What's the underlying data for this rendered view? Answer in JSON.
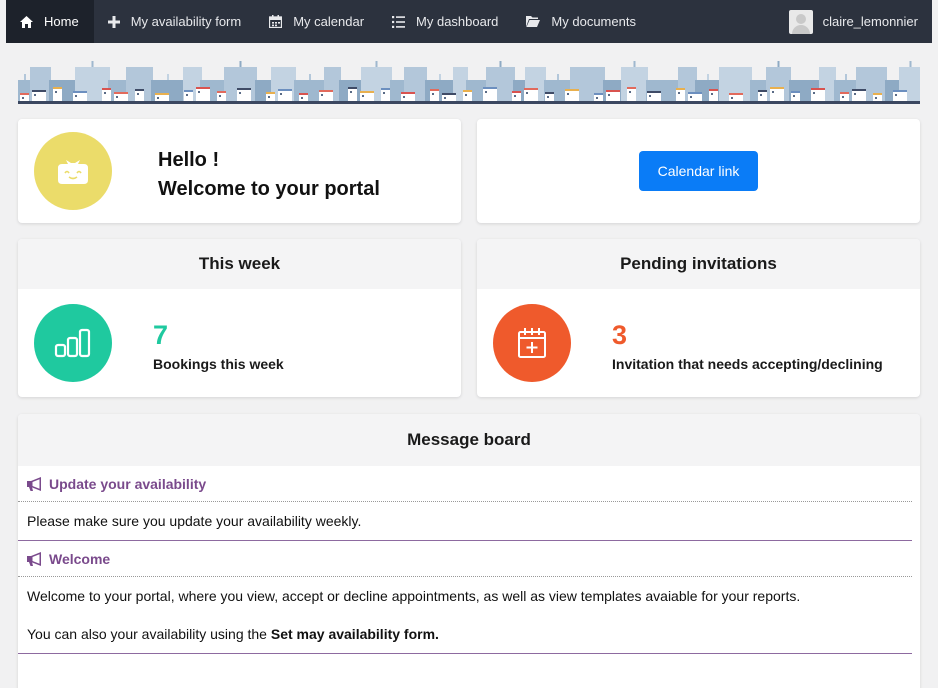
{
  "nav": {
    "items": [
      {
        "label": "Home",
        "icon": "home-icon",
        "active": true
      },
      {
        "label": "My availability form",
        "icon": "plus-icon"
      },
      {
        "label": "My calendar",
        "icon": "calendar-icon"
      },
      {
        "label": "My dashboard",
        "icon": "list-icon"
      },
      {
        "label": "My documents",
        "icon": "folder-icon"
      }
    ],
    "username": "claire_lemonnier"
  },
  "welcome": {
    "line1": "Hello !",
    "line2": "Welcome to your portal"
  },
  "calendar_button": "Calendar link",
  "week": {
    "title": "This week",
    "count": "7",
    "label": "Bookings this week",
    "icon": "bar-chart-icon",
    "color": "#1fc99f"
  },
  "pending": {
    "title": "Pending invitations",
    "count": "3",
    "label": "Invitation that needs accepting/declining",
    "icon": "calendar-add-icon",
    "color": "#ef5a2c"
  },
  "board": {
    "title": "Message board",
    "messages": [
      {
        "title": "Update your availability",
        "body": [
          "Please make sure you update your availability weekly."
        ]
      },
      {
        "title": "Welcome",
        "body": [
          "Welcome to your portal, where you view, accept or decline appointments, as well as view templates avaiable for your reports.",
          "You can also your availability using the "
        ],
        "body_bold": "Set may availability form."
      }
    ]
  },
  "colors": {
    "nav_bg": "#2c323e",
    "accent_purple": "#7a4a8c",
    "button_blue": "#0a7cf7",
    "welcome_yellow": "#ebdc6a"
  }
}
